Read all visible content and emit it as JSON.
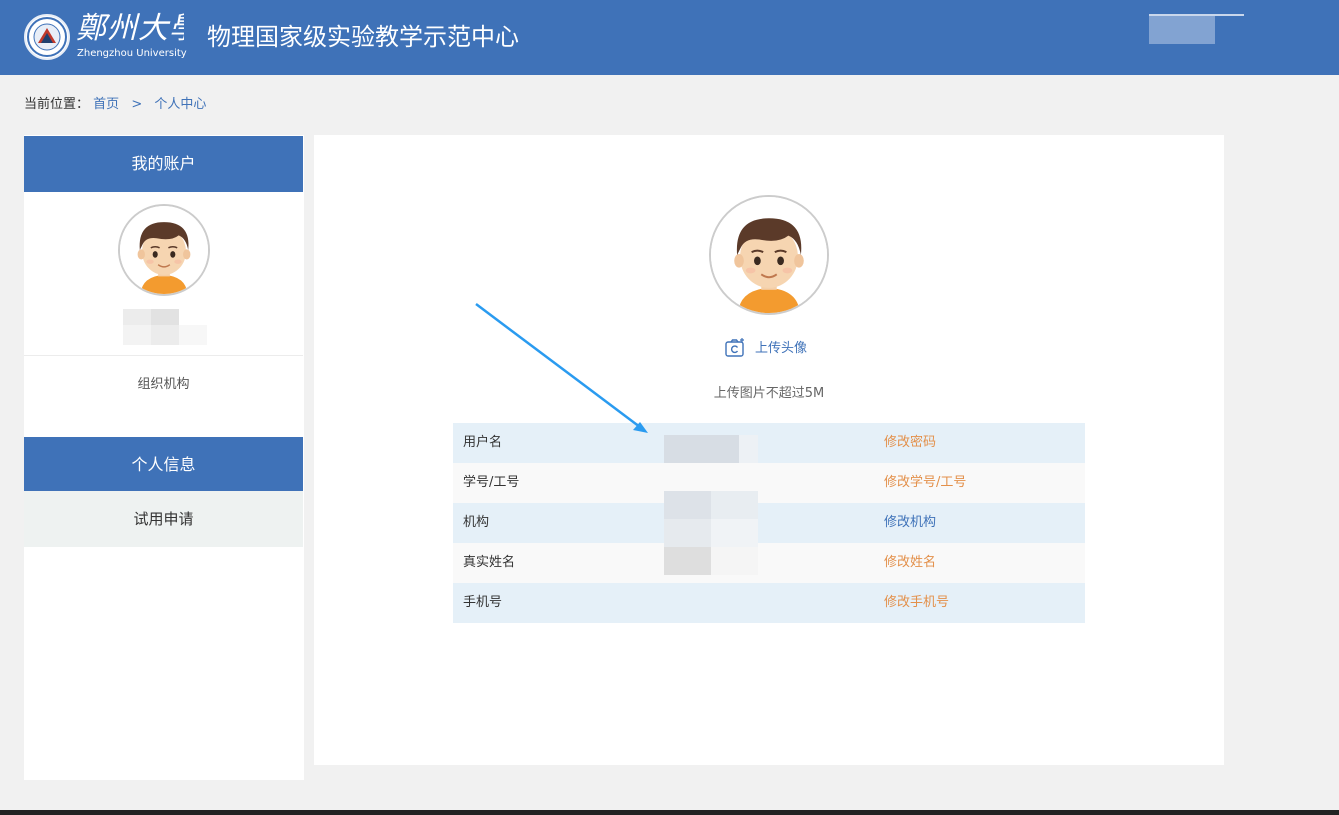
{
  "header": {
    "logo_cn": "鄭州大學",
    "logo_en": "Zhengzhou University",
    "site_title": "物理国家级实验教学示范中心"
  },
  "breadcrumb": {
    "prefix": "当前位置：",
    "home": "首页",
    "separator": ">",
    "current": "个人中心"
  },
  "sidebar": {
    "account_heading": "我的账户",
    "org_label": "组织机构",
    "personal_info": "个人信息",
    "trial_apply": "试用申请"
  },
  "main": {
    "upload_label": "上传头像",
    "upload_hint": "上传图片不超过5M",
    "rows": [
      {
        "label": "用户名",
        "action": "修改密码",
        "action_color": "#e3904a"
      },
      {
        "label": "学号/工号",
        "action": "修改学号/工号",
        "action_color": "#e3904a"
      },
      {
        "label": "机构",
        "action": "修改机构",
        "action_color": "#3f72b8"
      },
      {
        "label": "真实姓名",
        "action": "修改姓名",
        "action_color": "#e3904a"
      },
      {
        "label": "手机号",
        "action": "修改手机号",
        "action_color": "#e3904a"
      }
    ]
  },
  "colors": {
    "brand": "#3f72b8",
    "action_orange": "#e3904a",
    "annotation_arrow": "#2a9bf0"
  }
}
